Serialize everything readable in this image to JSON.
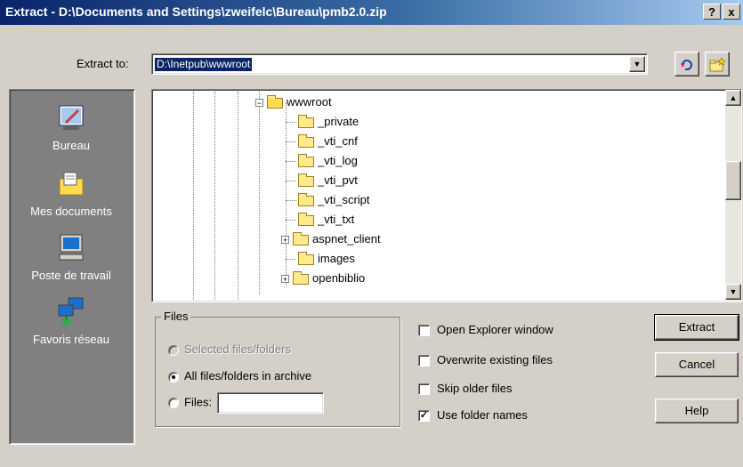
{
  "window": {
    "title": "Extract - D:\\Documents and Settings\\zweifelc\\Bureau\\pmb2.0.zip",
    "help_label": "?",
    "close_label": "x"
  },
  "extract_to": {
    "label": "Extract to:",
    "value": "D:\\Inetpub\\wwwroot"
  },
  "places": [
    {
      "label": "Bureau",
      "icon": "desktop-icon"
    },
    {
      "label": "Mes documents",
      "icon": "my-documents-icon"
    },
    {
      "label": "Poste de travail",
      "icon": "my-computer-icon"
    },
    {
      "label": "Favoris réseau",
      "icon": "network-places-icon"
    }
  ],
  "tree": {
    "nodes": [
      {
        "label": "wwwroot",
        "expander": "−",
        "open": true
      },
      {
        "label": "_private"
      },
      {
        "label": "_vti_cnf"
      },
      {
        "label": "_vti_log"
      },
      {
        "label": "_vti_pvt"
      },
      {
        "label": "_vti_script"
      },
      {
        "label": "_vti_txt"
      },
      {
        "label": "aspnet_client",
        "expander": "+"
      },
      {
        "label": "images"
      },
      {
        "label": "openbiblio",
        "expander": "+"
      }
    ]
  },
  "files_group": {
    "title": "Files",
    "selected_label": "Selected files/folders",
    "all_label": "All files/folders in archive",
    "files_label": "Files:",
    "files_value": ""
  },
  "options": {
    "open_explorer": {
      "label": "Open Explorer window",
      "checked": false
    },
    "overwrite": {
      "label": "Overwrite existing files",
      "checked": false
    },
    "skip_older": {
      "label": "Skip older files",
      "checked": false
    },
    "use_folder_names": {
      "label": "Use folder names",
      "checked": true
    }
  },
  "buttons": {
    "extract": "Extract",
    "cancel": "Cancel",
    "help": "Help"
  }
}
